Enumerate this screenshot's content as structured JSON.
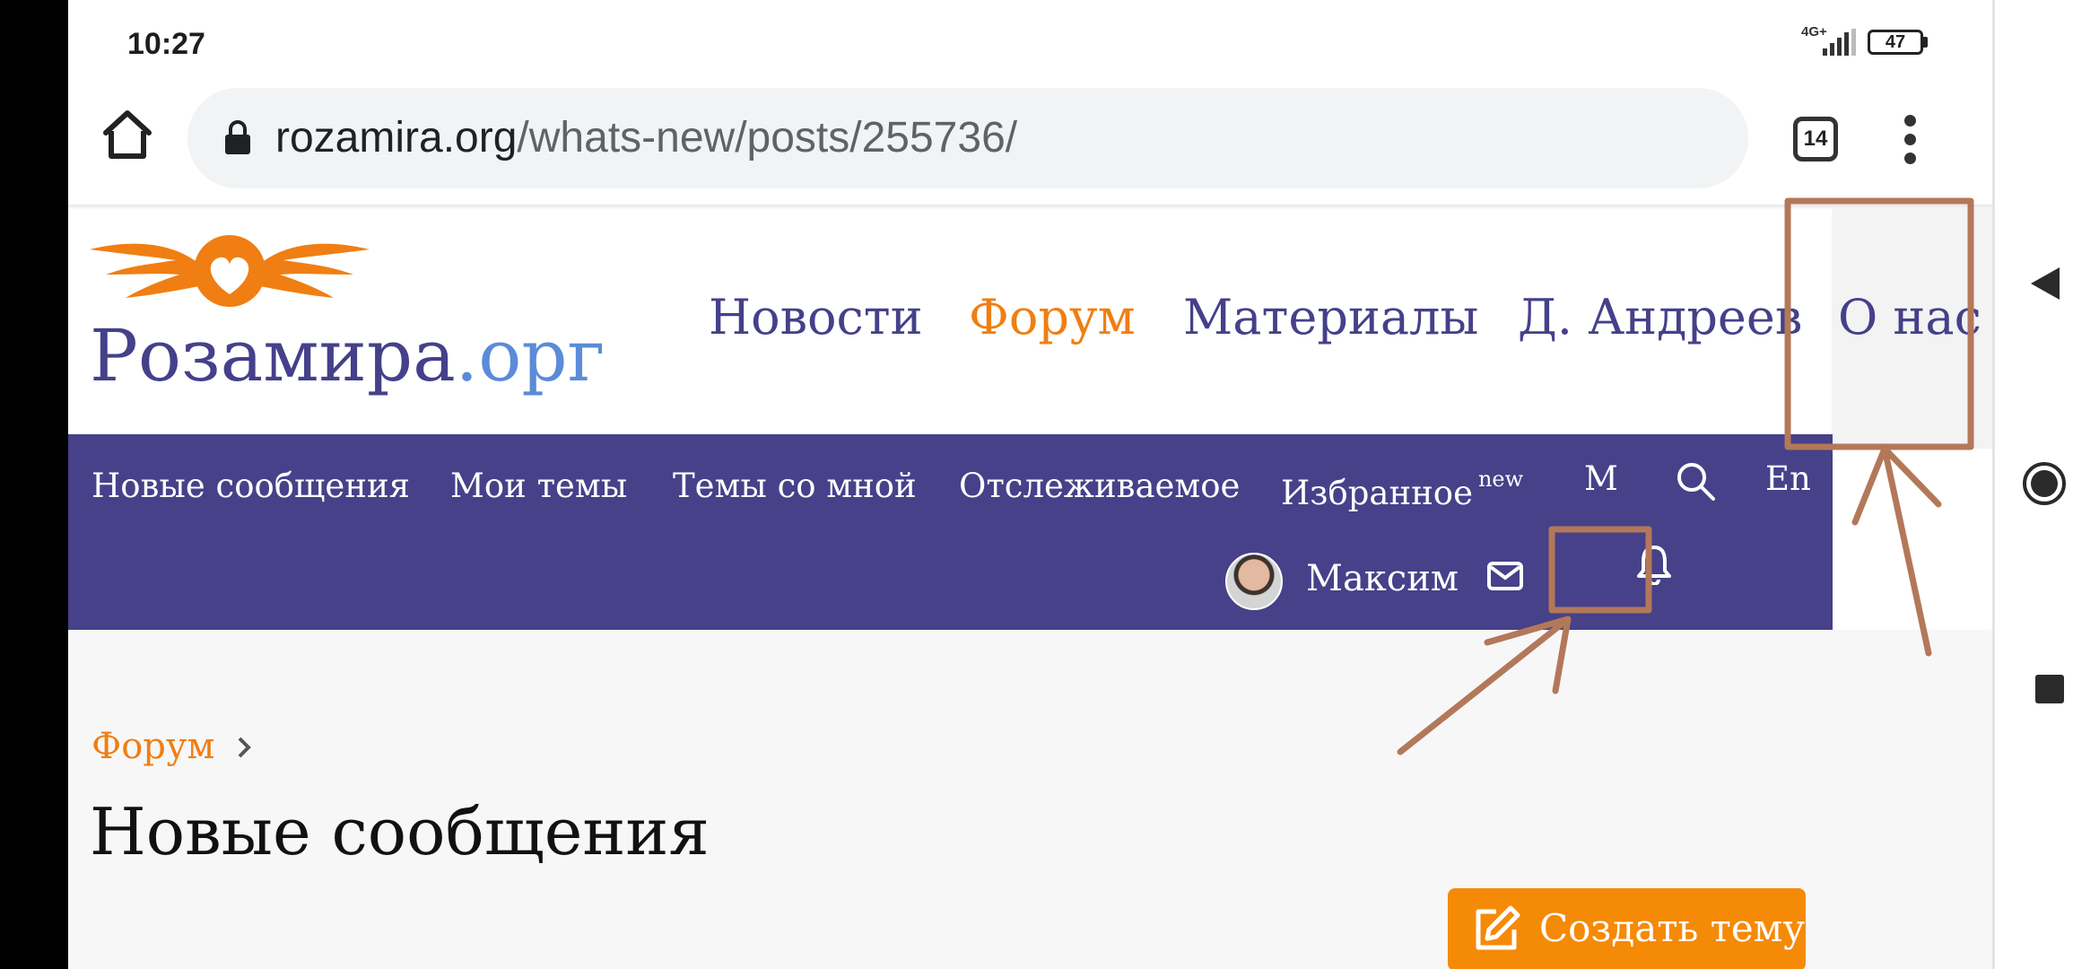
{
  "status_bar": {
    "time": "10:27",
    "network": "4G+",
    "battery": "47"
  },
  "browser": {
    "url_domain": "rozamira.org",
    "url_path": "/whats-new/posts/255736/",
    "tab_count": "14"
  },
  "site": {
    "brand_name": "Розамира",
    "brand_tld": ".орг",
    "main_nav": [
      "Новости",
      "Форум",
      "Материалы",
      "Д. Андреев",
      "О нас"
    ],
    "active_nav": "Форум"
  },
  "subnav": {
    "new_messages": "Новые сообщения",
    "my_threads": "Мои темы",
    "threads_with_me": "Темы со мной",
    "watched": "Отслеживаемое",
    "favorites": "Избранное",
    "favorites_badge": "new",
    "m_label": "M",
    "lang": "En",
    "user_name": "Максим"
  },
  "content": {
    "breadcrumb": "Форум",
    "title": "Новые сообщения",
    "create_button": "Создать тему"
  },
  "colors": {
    "brand_purple": "#464189",
    "accent_orange": "#f07e12",
    "annotation_brown": "#b3785a"
  },
  "icons": [
    "home-icon",
    "lock-icon",
    "tabs-icon",
    "more-vert-icon",
    "search-icon",
    "mail-icon",
    "bell-icon",
    "edit-icon",
    "chevron-right-icon",
    "back-icon",
    "home-circle-icon",
    "recents-icon"
  ]
}
